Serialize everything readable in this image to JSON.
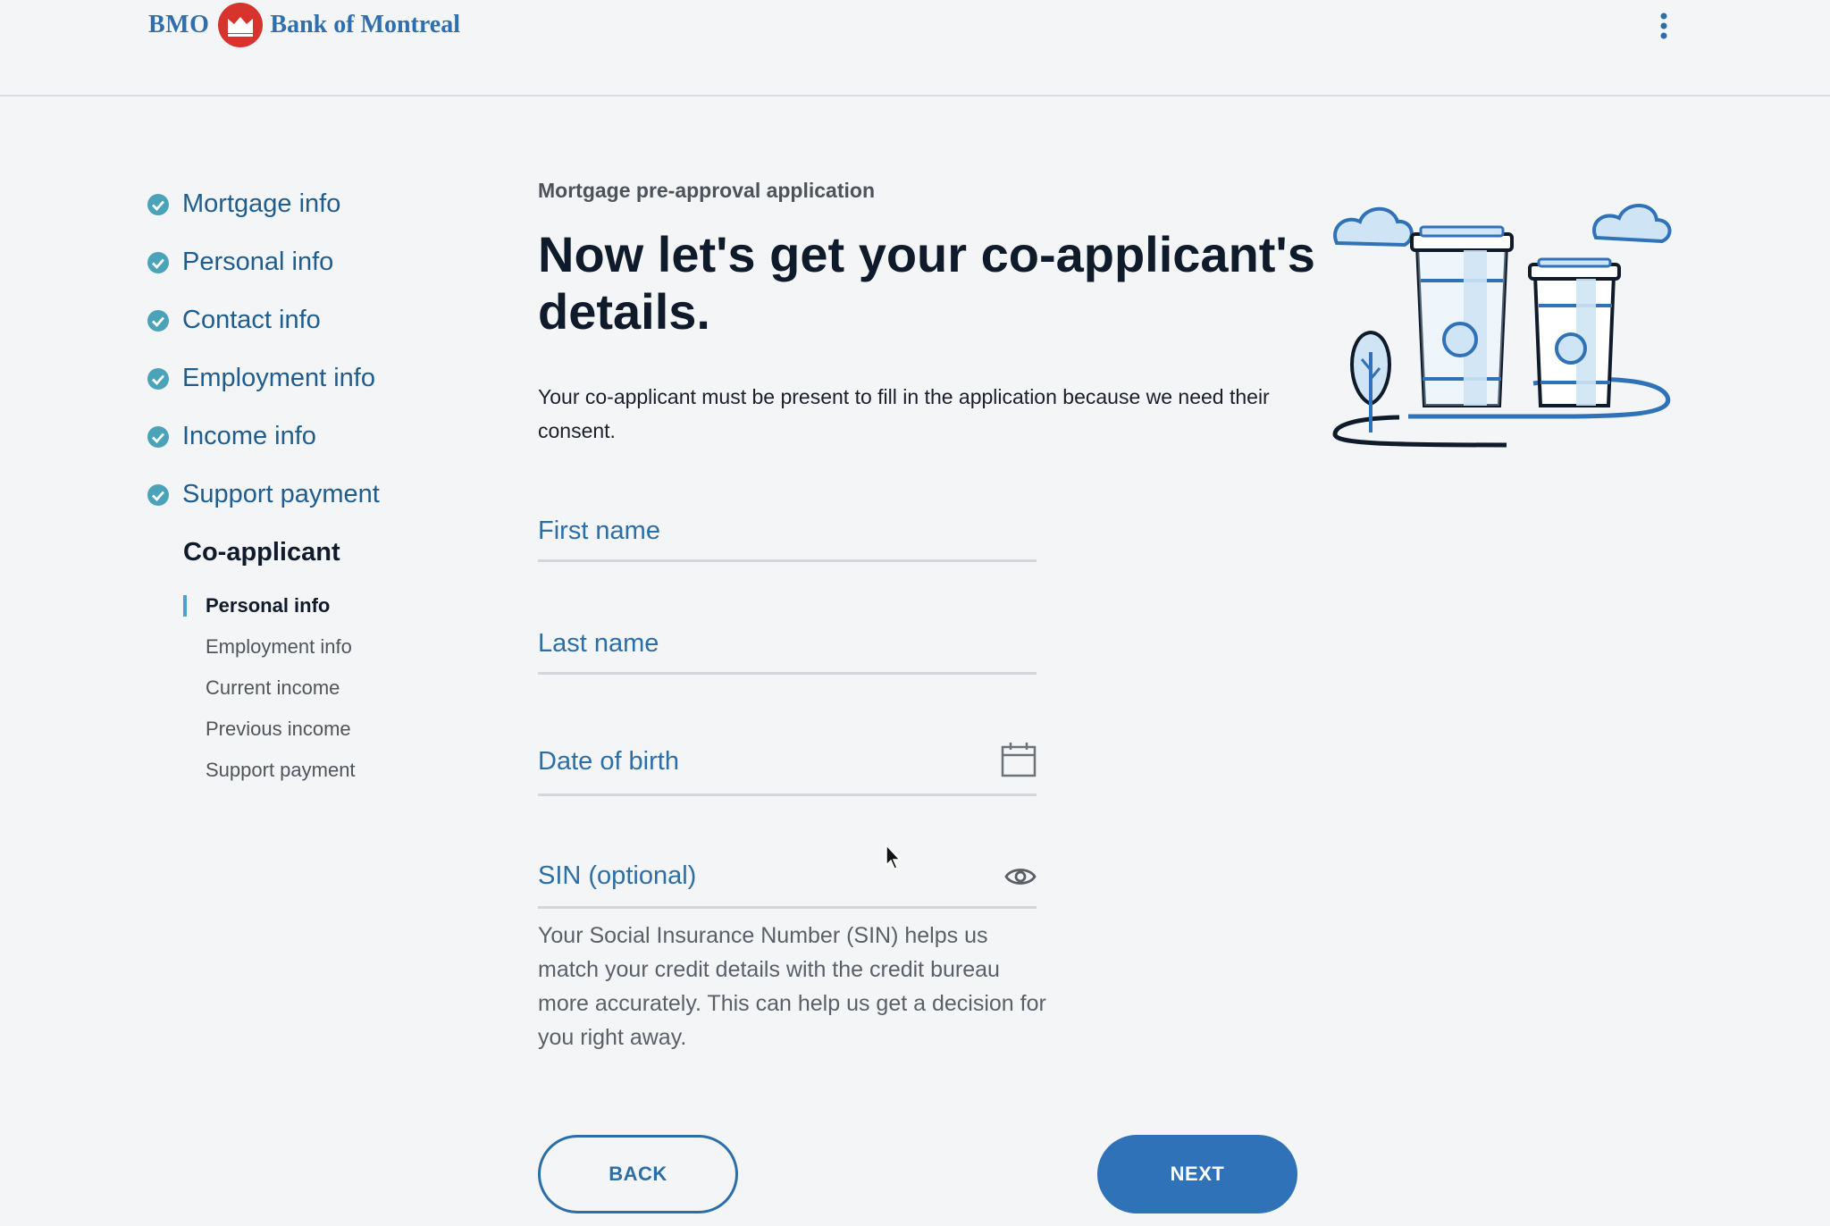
{
  "header": {
    "logo_text": "BMO",
    "bank_name": "Bank of Montreal",
    "menu_icon": "kebab-menu-icon"
  },
  "sidebar": {
    "steps": [
      {
        "label": "Mortgage info",
        "status": "complete"
      },
      {
        "label": "Personal info",
        "status": "complete"
      },
      {
        "label": "Contact info",
        "status": "complete"
      },
      {
        "label": "Employment info",
        "status": "complete"
      },
      {
        "label": "Income info",
        "status": "complete"
      },
      {
        "label": "Support payment",
        "status": "complete"
      }
    ],
    "current_step": "Co-applicant",
    "substeps": [
      {
        "label": "Personal info",
        "active": true
      },
      {
        "label": "Employment info",
        "active": false
      },
      {
        "label": "Current income",
        "active": false
      },
      {
        "label": "Previous income",
        "active": false
      },
      {
        "label": "Support payment",
        "active": false
      }
    ],
    "check_color": "#4aa3b8"
  },
  "main": {
    "eyebrow": "Mortgage pre-approval application",
    "title": "Now let's get your co-applicant's details.",
    "intro": "Your co-applicant must be present to fill in the application because we need their consent."
  },
  "form": {
    "first_name_label": "First name",
    "last_name_label": "Last name",
    "dob_label": "Date of birth",
    "dob_icon": "calendar-icon",
    "sin_label": "SIN (optional)",
    "sin_icon": "eye-icon",
    "sin_helper": "Your Social Insurance Number (SIN) helps us match your credit details with the credit bureau more accurately. This can help us get a decision for you right away."
  },
  "buttons": {
    "back_label": "BACK",
    "next_label": "NEXT"
  },
  "colors": {
    "brand_blue": "#2f72b7",
    "brand_red": "#d8342e",
    "background": "#f4f5f7"
  }
}
